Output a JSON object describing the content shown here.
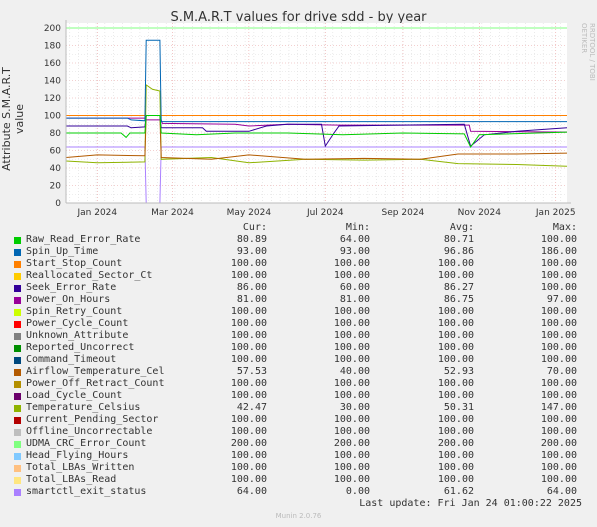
{
  "chart_data": {
    "type": "line",
    "title": "S.M.A.R.T values for drive sdd - by year",
    "ylabel": "Attribute S.M.A.R.T value",
    "ylim": [
      0,
      200
    ],
    "yticks": [
      0,
      20,
      40,
      60,
      80,
      100,
      120,
      140,
      160,
      180,
      200
    ],
    "xlim": [
      "2023-12-07",
      "2025-01-10"
    ],
    "xticks": [
      {
        "date": "2024-01-01",
        "label": "Jan 2024"
      },
      {
        "date": "2024-03-01",
        "label": "Mar 2024"
      },
      {
        "date": "2024-05-01",
        "label": "May 2024"
      },
      {
        "date": "2024-07-01",
        "label": "Jul 2024"
      },
      {
        "date": "2024-09-01",
        "label": "Sep 2024"
      },
      {
        "date": "2024-11-01",
        "label": "Nov 2024"
      },
      {
        "date": "2025-01-01",
        "label": "Jan 2025"
      }
    ],
    "grid": true,
    "legend_placement": "bottom",
    "columns": [
      "Cur:",
      "Min:",
      "Avg:",
      "Max:"
    ],
    "series": [
      {
        "name": "Raw_Read_Error_Rate",
        "color": "#00cc00",
        "cur": "80.89",
        "min": "64.00",
        "avg": "80.71",
        "max": "100.00",
        "points": [
          [
            "2023-12-07",
            80
          ],
          [
            "2024-01-20",
            80
          ],
          [
            "2024-01-24",
            75
          ],
          [
            "2024-01-27",
            80
          ],
          [
            "2024-02-08",
            80
          ],
          [
            "2024-02-09",
            100
          ],
          [
            "2024-02-20",
            100
          ],
          [
            "2024-02-21",
            80
          ],
          [
            "2024-03-20",
            78
          ],
          [
            "2024-04-20",
            80
          ],
          [
            "2024-06-01",
            80
          ],
          [
            "2024-07-15",
            78
          ],
          [
            "2024-09-01",
            80
          ],
          [
            "2024-10-20",
            79
          ],
          [
            "2024-10-25",
            64
          ],
          [
            "2024-11-01",
            78
          ],
          [
            "2025-01-10",
            81
          ]
        ]
      },
      {
        "name": "Spin_Up_Time",
        "color": "#0066b3",
        "cur": "93.00",
        "min": "93.00",
        "avg": "96.86",
        "max": "186.00",
        "points": [
          [
            "2023-12-07",
            97
          ],
          [
            "2024-01-25",
            97
          ],
          [
            "2024-01-28",
            95
          ],
          [
            "2024-02-08",
            94
          ],
          [
            "2024-02-09",
            186
          ],
          [
            "2024-02-20",
            186
          ],
          [
            "2024-02-21",
            93
          ],
          [
            "2025-01-10",
            93
          ]
        ]
      },
      {
        "name": "Start_Stop_Count",
        "color": "#ff8000",
        "cur": "100.00",
        "min": "100.00",
        "avg": "100.00",
        "max": "100.00",
        "points": [
          [
            "2023-12-07",
            100
          ],
          [
            "2025-01-10",
            100
          ]
        ]
      },
      {
        "name": "Reallocated_Sector_Ct",
        "color": "#ffcc00",
        "cur": "100.00",
        "min": "100.00",
        "avg": "100.00",
        "max": "100.00",
        "points": [
          [
            "2023-12-07",
            100
          ],
          [
            "2025-01-10",
            100
          ]
        ]
      },
      {
        "name": "Seek_Error_Rate",
        "color": "#330099",
        "cur": "86.00",
        "min": "60.00",
        "avg": "86.27",
        "max": "100.00",
        "points": [
          [
            "2023-12-07",
            88
          ],
          [
            "2024-01-25",
            88
          ],
          [
            "2024-01-28",
            86
          ],
          [
            "2024-02-08",
            87
          ],
          [
            "2024-02-09",
            100
          ],
          [
            "2024-02-20",
            100
          ],
          [
            "2024-02-21",
            86
          ],
          [
            "2024-03-25",
            86
          ],
          [
            "2024-03-28",
            82
          ],
          [
            "2024-05-01",
            82
          ],
          [
            "2024-05-15",
            88
          ],
          [
            "2024-06-01",
            90
          ],
          [
            "2024-06-28",
            90
          ],
          [
            "2024-07-01",
            65
          ],
          [
            "2024-07-08",
            80
          ],
          [
            "2024-07-12",
            88
          ],
          [
            "2024-10-20",
            90
          ],
          [
            "2024-10-25",
            65
          ],
          [
            "2024-11-05",
            78
          ],
          [
            "2024-12-01",
            82
          ],
          [
            "2025-01-10",
            86
          ]
        ]
      },
      {
        "name": "Power_On_Hours",
        "color": "#990099",
        "cur": "81.00",
        "min": "81.00",
        "avg": "86.75",
        "max": "97.00",
        "points": [
          [
            "2023-12-07",
            97
          ],
          [
            "2024-02-08",
            97
          ],
          [
            "2024-02-09",
            95
          ],
          [
            "2024-02-21",
            95
          ],
          [
            "2024-02-22",
            91
          ],
          [
            "2024-04-20",
            90
          ],
          [
            "2024-05-01",
            88
          ],
          [
            "2024-06-01",
            90
          ],
          [
            "2024-07-12",
            89
          ],
          [
            "2024-10-24",
            89
          ],
          [
            "2024-10-25",
            82
          ],
          [
            "2025-01-10",
            81
          ]
        ]
      },
      {
        "name": "Spin_Retry_Count",
        "color": "#ccff00",
        "cur": "100.00",
        "min": "100.00",
        "avg": "100.00",
        "max": "100.00",
        "points": [
          [
            "2023-12-07",
            100
          ],
          [
            "2025-01-10",
            100
          ]
        ]
      },
      {
        "name": "Power_Cycle_Count",
        "color": "#ff0000",
        "cur": "100.00",
        "min": "100.00",
        "avg": "100.00",
        "max": "100.00",
        "points": [
          [
            "2023-12-07",
            100
          ],
          [
            "2025-01-10",
            100
          ]
        ]
      },
      {
        "name": "Unknown_Attribute",
        "color": "#808080",
        "cur": "100.00",
        "min": "100.00",
        "avg": "100.00",
        "max": "100.00",
        "points": [
          [
            "2023-12-07",
            100
          ],
          [
            "2025-01-10",
            100
          ]
        ]
      },
      {
        "name": "Reported_Uncorrect",
        "color": "#008f00",
        "cur": "100.00",
        "min": "100.00",
        "avg": "100.00",
        "max": "100.00",
        "points": [
          [
            "2023-12-07",
            100
          ],
          [
            "2025-01-10",
            100
          ]
        ]
      },
      {
        "name": "Command_Timeout",
        "color": "#00487d",
        "cur": "100.00",
        "min": "100.00",
        "avg": "100.00",
        "max": "100.00",
        "points": [
          [
            "2023-12-07",
            100
          ],
          [
            "2025-01-10",
            100
          ]
        ]
      },
      {
        "name": "Airflow_Temperature_Cel",
        "color": "#b35a00",
        "cur": "57.53",
        "min": "40.00",
        "avg": "52.93",
        "max": "70.00",
        "points": [
          [
            "2023-12-07",
            52
          ],
          [
            "2024-01-01",
            55
          ],
          [
            "2024-02-08",
            54
          ],
          [
            "2024-02-09",
            100
          ],
          [
            "2024-02-20",
            100
          ],
          [
            "2024-02-21",
            52
          ],
          [
            "2024-04-01",
            50
          ],
          [
            "2024-05-01",
            55
          ],
          [
            "2024-06-15",
            50
          ],
          [
            "2024-08-01",
            51
          ],
          [
            "2024-09-15",
            50
          ],
          [
            "2024-10-15",
            56
          ],
          [
            "2024-12-01",
            56
          ],
          [
            "2025-01-10",
            57
          ]
        ]
      },
      {
        "name": "Power_Off_Retract_Count",
        "color": "#b38f00",
        "cur": "100.00",
        "min": "100.00",
        "avg": "100.00",
        "max": "100.00",
        "points": [
          [
            "2023-12-07",
            100
          ],
          [
            "2025-01-10",
            100
          ]
        ]
      },
      {
        "name": "Load_Cycle_Count",
        "color": "#6b006b",
        "cur": "100.00",
        "min": "100.00",
        "avg": "100.00",
        "max": "100.00",
        "points": [
          [
            "2023-12-07",
            100
          ],
          [
            "2025-01-10",
            100
          ]
        ]
      },
      {
        "name": "Temperature_Celsius",
        "color": "#8fb300",
        "cur": "42.47",
        "min": "30.00",
        "avg": "50.31",
        "max": "147.00",
        "points": [
          [
            "2023-12-07",
            48
          ],
          [
            "2024-01-01",
            46
          ],
          [
            "2024-02-08",
            47
          ],
          [
            "2024-02-09",
            135
          ],
          [
            "2024-02-14",
            130
          ],
          [
            "2024-02-20",
            128
          ],
          [
            "2024-02-21",
            50
          ],
          [
            "2024-04-01",
            52
          ],
          [
            "2024-05-01",
            46
          ],
          [
            "2024-06-15",
            50
          ],
          [
            "2024-08-01",
            49
          ],
          [
            "2024-09-15",
            50
          ],
          [
            "2024-10-15",
            45
          ],
          [
            "2024-12-01",
            44
          ],
          [
            "2025-01-10",
            42
          ]
        ]
      },
      {
        "name": "Current_Pending_Sector",
        "color": "#b30000",
        "cur": "100.00",
        "min": "100.00",
        "avg": "100.00",
        "max": "100.00",
        "points": [
          [
            "2023-12-07",
            100
          ],
          [
            "2025-01-10",
            100
          ]
        ]
      },
      {
        "name": "Offline_Uncorrectable",
        "color": "#bebebe",
        "cur": "100.00",
        "min": "100.00",
        "avg": "100.00",
        "max": "100.00",
        "points": [
          [
            "2023-12-07",
            100
          ],
          [
            "2025-01-10",
            100
          ]
        ]
      },
      {
        "name": "UDMA_CRC_Error_Count",
        "color": "#80ff80",
        "cur": "200.00",
        "min": "200.00",
        "avg": "200.00",
        "max": "200.00",
        "points": [
          [
            "2023-12-07",
            200
          ],
          [
            "2025-01-10",
            200
          ]
        ]
      },
      {
        "name": "Head_Flying_Hours",
        "color": "#80c9ff",
        "cur": "100.00",
        "min": "100.00",
        "avg": "100.00",
        "max": "100.00",
        "points": [
          [
            "2023-12-07",
            100
          ],
          [
            "2025-01-10",
            100
          ]
        ]
      },
      {
        "name": "Total_LBAs_Written",
        "color": "#ffc080",
        "cur": "100.00",
        "min": "100.00",
        "avg": "100.00",
        "max": "100.00",
        "points": [
          [
            "2023-12-07",
            100
          ],
          [
            "2025-01-10",
            100
          ]
        ]
      },
      {
        "name": "Total_LBAs_Read",
        "color": "#ffe680",
        "cur": "100.00",
        "min": "100.00",
        "avg": "100.00",
        "max": "100.00",
        "points": [
          [
            "2023-12-07",
            100
          ],
          [
            "2025-01-10",
            100
          ]
        ]
      },
      {
        "name": "smartctl_exit_status",
        "color": "#aa80ff",
        "cur": "64.00",
        "min": "0.00",
        "avg": "61.62",
        "max": "64.00",
        "points": [
          [
            "2023-12-07",
            64
          ],
          [
            "2024-02-08",
            64
          ],
          [
            "2024-02-09",
            0
          ],
          [
            "2024-02-20",
            0
          ],
          [
            "2024-02-21",
            64
          ],
          [
            "2025-01-10",
            64
          ]
        ]
      }
    ]
  },
  "side_label": "RRDTOOL / TOBI OETIKER",
  "last_update": "Last update: Fri Jan 24 01:00:22 2025",
  "version": "Munin 2.0.76"
}
